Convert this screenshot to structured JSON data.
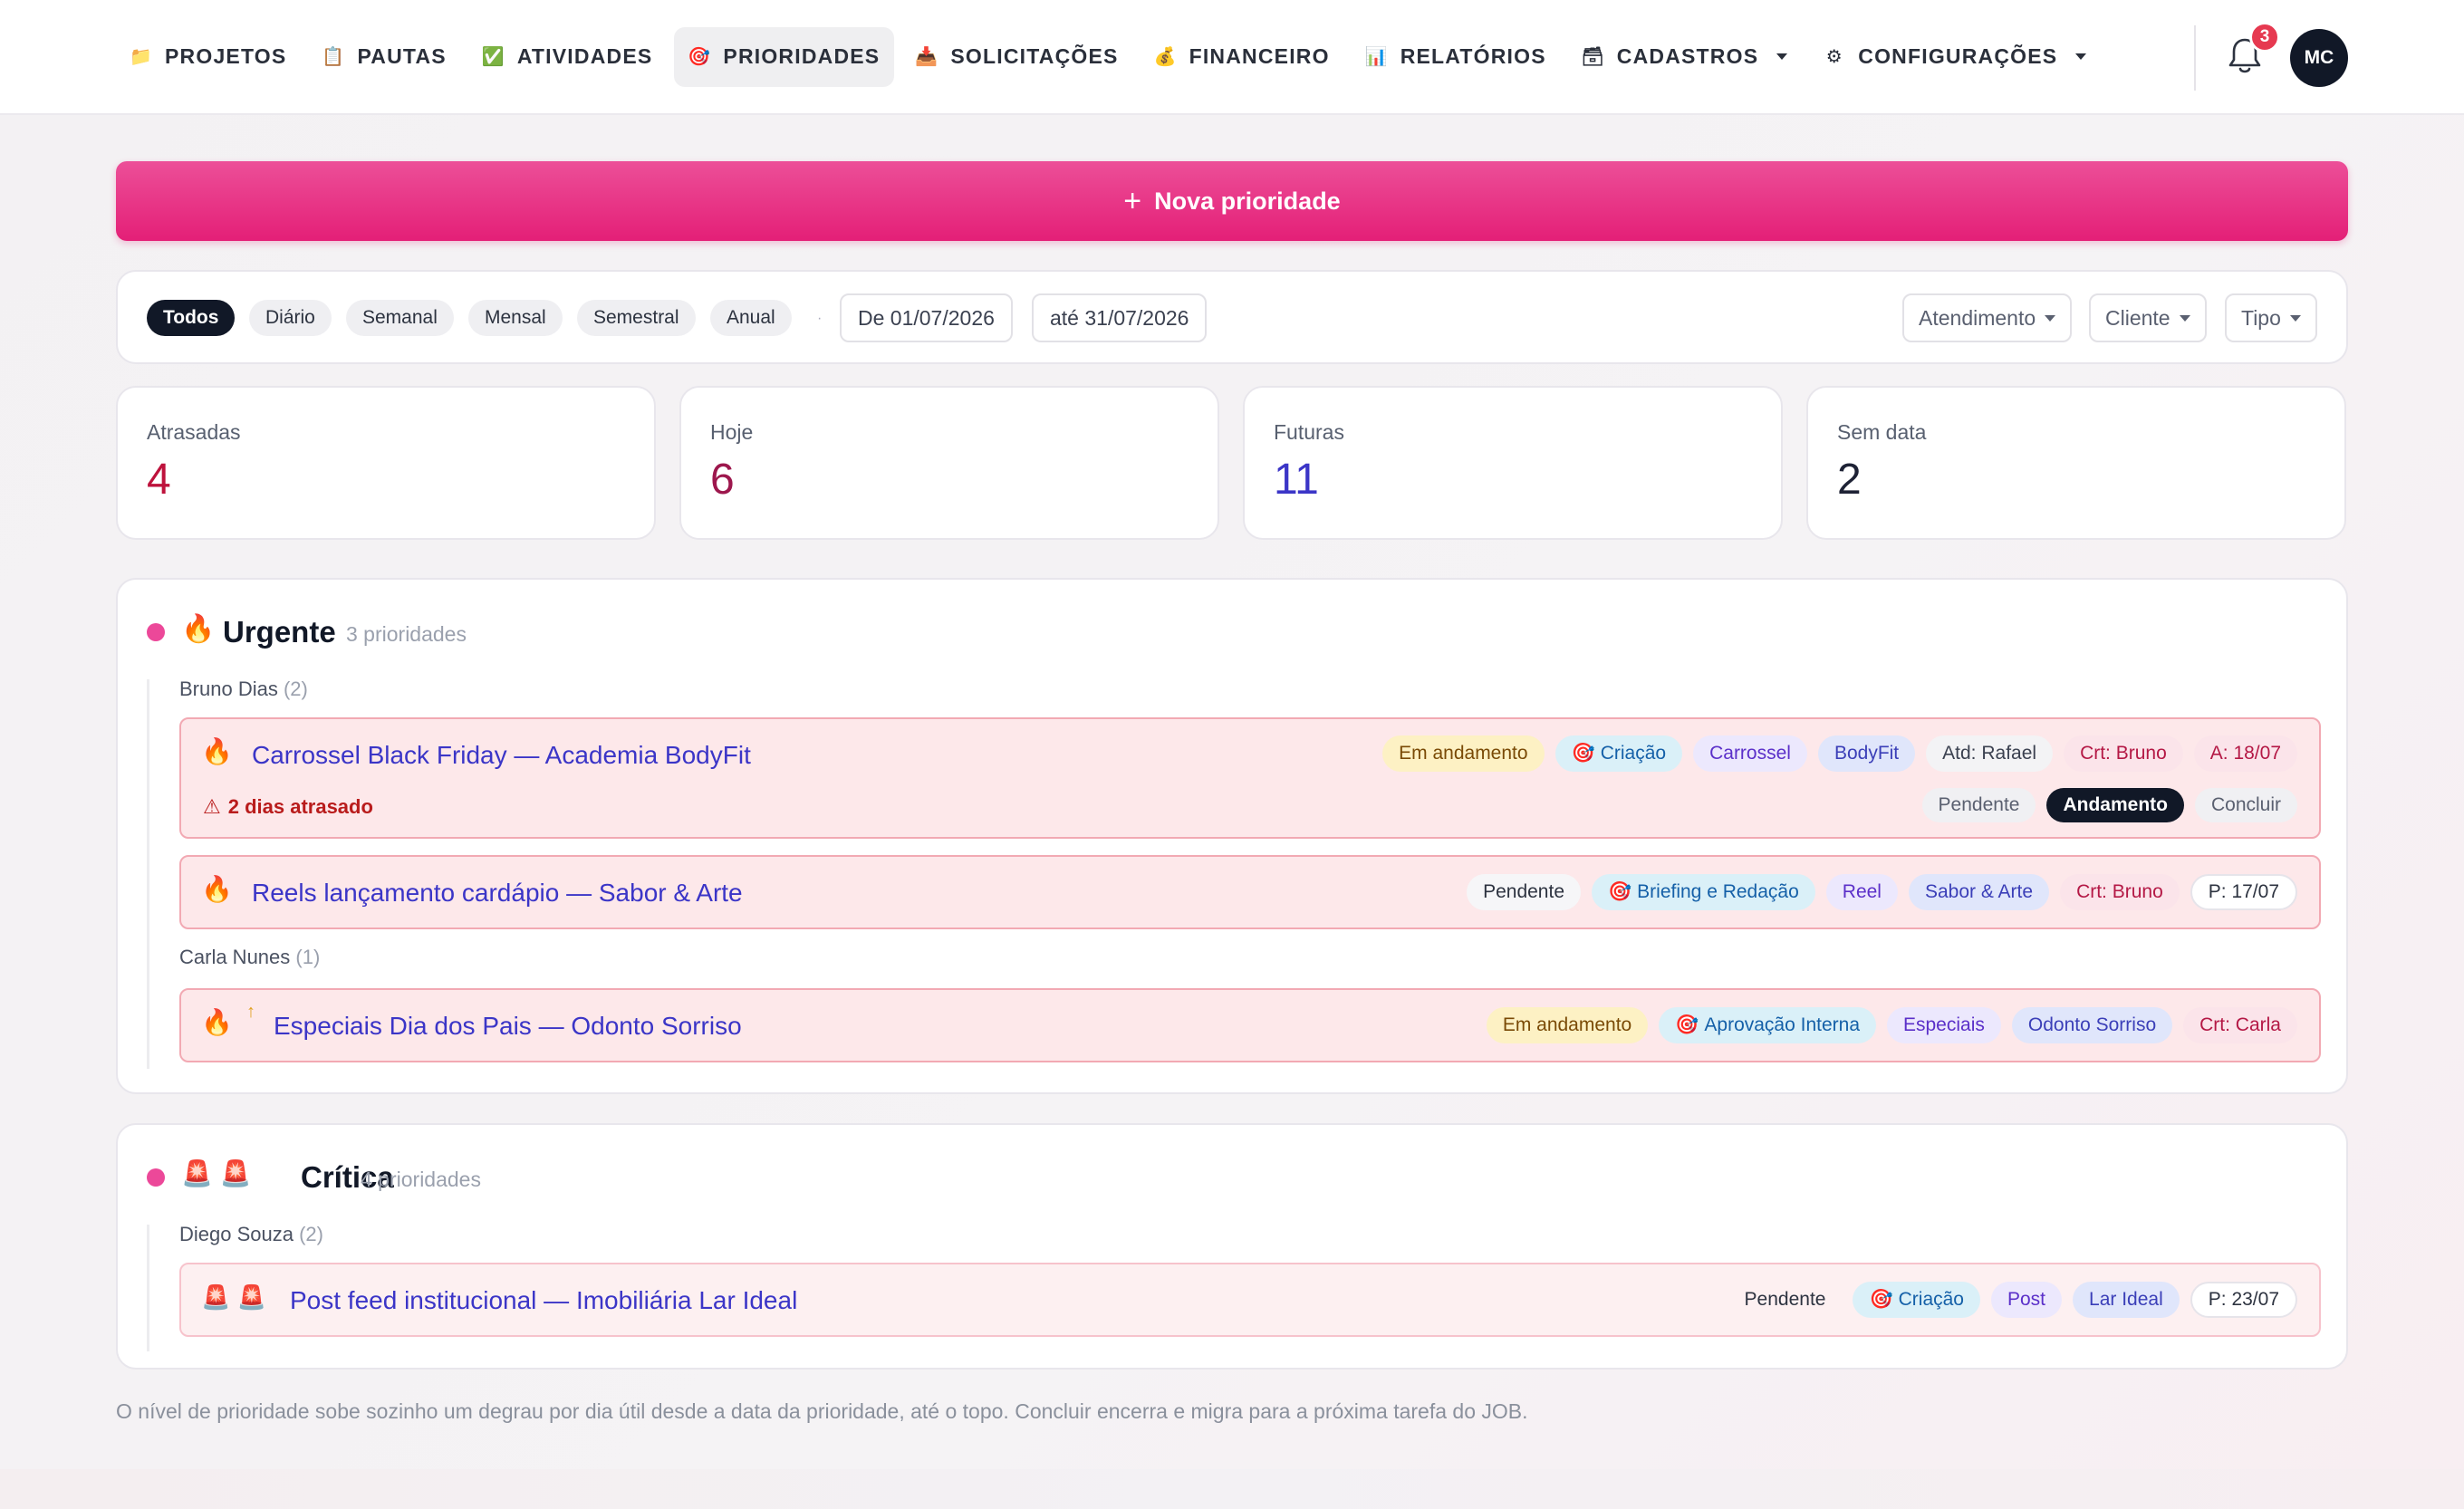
{
  "nav": {
    "items": [
      {
        "label": "PROJETOS",
        "icon": "📁"
      },
      {
        "label": "PAUTAS",
        "icon": "📋"
      },
      {
        "label": "ATIVIDADES",
        "icon": "✅"
      },
      {
        "label": "PRIORIDADES",
        "icon": "🎯"
      },
      {
        "label": "SOLICITAÇÕES",
        "icon": "📥"
      },
      {
        "label": "FINANCEIRO",
        "icon": "💰"
      },
      {
        "label": "RELATÓRIOS",
        "icon": "📊"
      },
      {
        "label": "CADASTROS",
        "icon": "🗃"
      },
      {
        "label": "CONFIGURAÇÕES",
        "icon": "⚙"
      }
    ],
    "active": "PRIORIDADES",
    "notifications": "3",
    "avatar": "MC"
  },
  "new_button": {
    "icon": "+",
    "label": "Nova prioridade"
  },
  "filters": {
    "periods": [
      "Todos",
      "Diário",
      "Semanal",
      "Mensal",
      "Semestral",
      "Anual"
    ],
    "active_period": "Todos",
    "date_from": "De 01/07/2026",
    "date_to": "até 31/07/2026",
    "dropdowns": [
      "Atendimento",
      "Cliente",
      "Tipo"
    ]
  },
  "stats": [
    {
      "label": "Atrasadas",
      "value": "4",
      "color": "#be123c"
    },
    {
      "label": "Hoje",
      "value": "6",
      "color": "#9d174d"
    },
    {
      "label": "Futuras",
      "value": "11",
      "color": "#3b35c7"
    },
    {
      "label": "Sem data",
      "value": "2",
      "color": "#1e2235"
    }
  ],
  "groups": {
    "urgente": {
      "emoji": "🔥",
      "title": "Urgente",
      "count": "3 prioridades",
      "people": [
        {
          "name": "Bruno Dias",
          "count": "(2)"
        },
        {
          "name": "Carla Nunes",
          "count": "(1)"
        }
      ],
      "items": [
        {
          "icon": "🔥",
          "title": "Carrossel Black Friday — Academia BodyFit",
          "tags": {
            "status": "Em andamento",
            "etapa": "Criação",
            "tipo": "Carrossel",
            "cliente": "BodyFit",
            "atd": "Atd: Rafael",
            "crt": "Crt: Bruno",
            "date": "A: 18/07"
          },
          "warning": "2 dias atrasado",
          "actions": [
            "Pendente",
            "Andamento",
            "Concluir"
          ]
        },
        {
          "icon": "🔥",
          "title": "Reels lançamento cardápio — Sabor & Arte",
          "tags": {
            "status": "Pendente",
            "etapa": "Briefing e Redação",
            "tipo": "Reel",
            "cliente": "Sabor & Arte",
            "crt": "Crt: Bruno",
            "date": "P: 17/07"
          }
        },
        {
          "icon": "🔥",
          "arrow": "↑",
          "title": "Especiais Dia dos Pais — Odonto Sorriso",
          "tags": {
            "status": "Em andamento",
            "etapa": "Aprovação Interna",
            "tipo": "Especiais",
            "cliente": "Odonto Sorriso",
            "crt": "Crt: Carla"
          }
        }
      ]
    },
    "critica": {
      "emoji": "🚨 🚨",
      "title": "Crítica",
      "count": "4 prioridades",
      "people": [
        {
          "name": "Diego Souza",
          "count": "(2)"
        }
      ],
      "items": [
        {
          "icon": "🚨 🚨",
          "title": "Post feed institucional — Imobiliária Lar Ideal",
          "tags": {
            "status": "Pendente",
            "etapa": "Criação",
            "tipo": "Post",
            "cliente": "Lar Ideal",
            "date": "P: 23/07"
          }
        }
      ]
    }
  },
  "footer_note": "O nível de prioridade sobe sozinho um degrau por dia útil desde a data da prioridade, até o topo. Concluir encerra e migra para a próxima tarefa do JOB.",
  "colors": {
    "accent": "#e41f77",
    "link": "#3b35c7",
    "group_dot": "#ec4899"
  }
}
